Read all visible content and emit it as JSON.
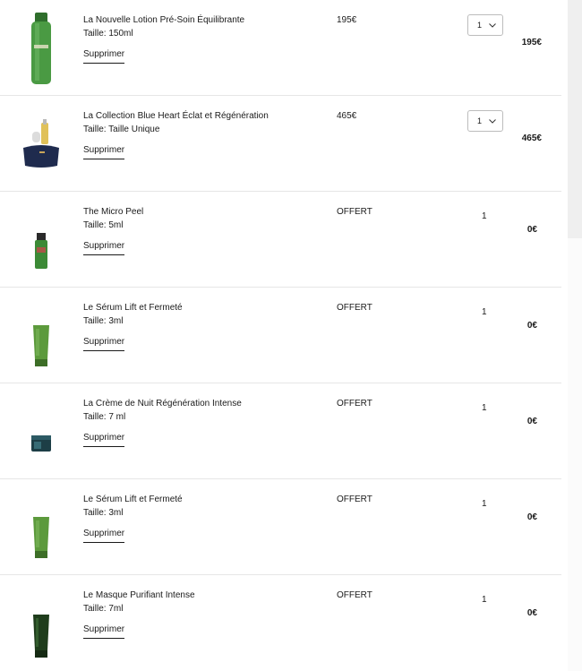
{
  "cart": {
    "remove_label": "Supprimer",
    "items": [
      {
        "name": "La Nouvelle Lotion Pré-Soin Équilibrante",
        "size": "Taille: 150ml",
        "price": "195€",
        "qty": "1",
        "total": "195€",
        "qty_type": "select",
        "image": "lotion-bottle-image"
      },
      {
        "name": "La Collection Blue Heart Éclat et Régénération",
        "size": "Taille: Taille Unique",
        "price": "465€",
        "qty": "1",
        "total": "465€",
        "qty_type": "select",
        "image": "gift-collection-image"
      },
      {
        "name": "The Micro Peel",
        "size": "Taille: 5ml",
        "price": "OFFERT",
        "qty": "1",
        "total": "0€",
        "qty_type": "static",
        "image": "micro-peel-bottle-image"
      },
      {
        "name": "Le Sérum Lift et Fermeté",
        "size": "Taille: 3ml",
        "price": "OFFERT",
        "qty": "1",
        "total": "0€",
        "qty_type": "static",
        "image": "serum-tube-image"
      },
      {
        "name": "La Crème de Nuit Régénération Intense",
        "size": "Taille: 7 ml",
        "price": "OFFERT",
        "qty": "1",
        "total": "0€",
        "qty_type": "static",
        "image": "cream-jar-image"
      },
      {
        "name": "Le Sérum Lift et Fermeté",
        "size": "Taille: 3ml",
        "price": "OFFERT",
        "qty": "1",
        "total": "0€",
        "qty_type": "static",
        "image": "serum-tube-image"
      },
      {
        "name": "Le Masque Purifiant Intense",
        "size": "Taille: 7ml",
        "price": "OFFERT",
        "qty": "1",
        "total": "0€",
        "qty_type": "static",
        "image": "mask-tube-image"
      }
    ]
  },
  "icons": {
    "chevron": "chevron-down-icon"
  },
  "colors": {
    "bottle_green": "#3f8f3a",
    "navy": "#1f2b4e",
    "text": "#1a1a1a",
    "divider": "#e6e6e6"
  }
}
